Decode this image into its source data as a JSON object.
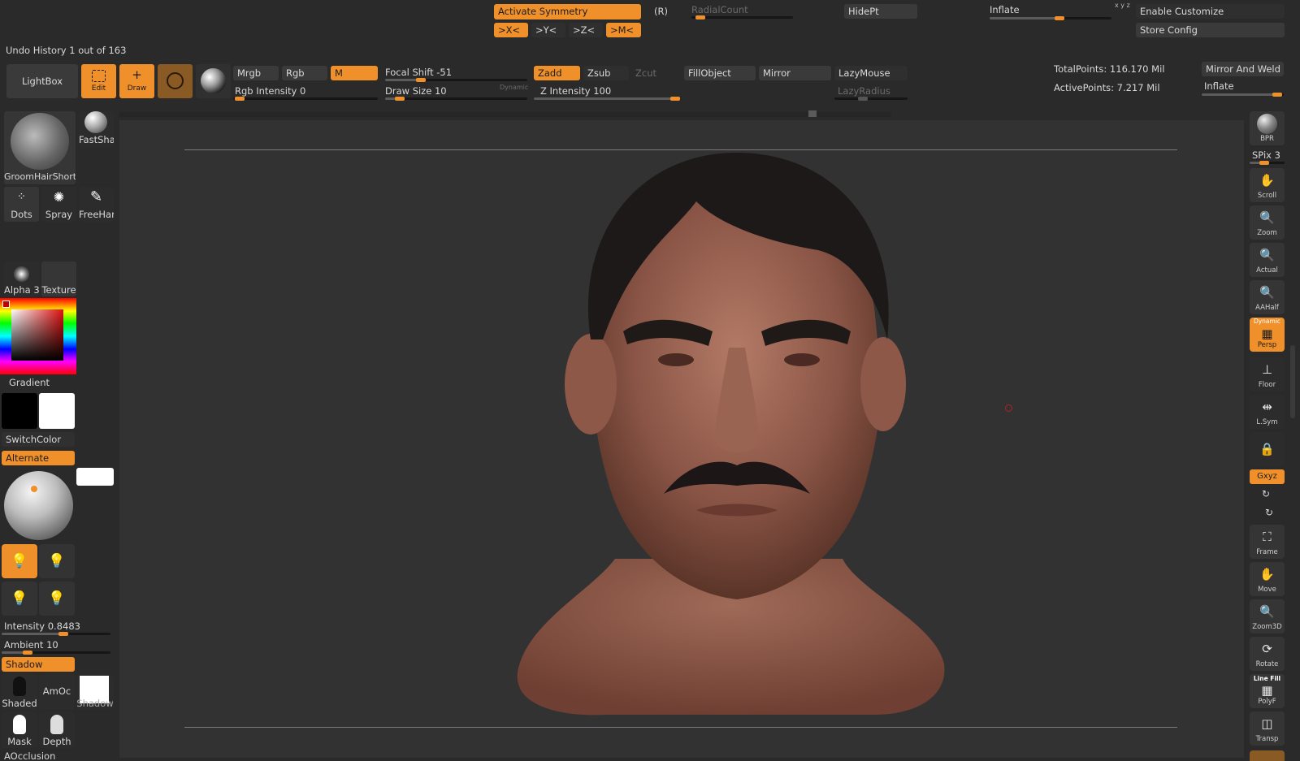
{
  "top": {
    "activate_symmetry": "Activate Symmetry",
    "radial_r": "(R)",
    "radial_count": "RadialCount",
    "hide_pt": "HidePt",
    "inflate_top": "Inflate",
    "xyz_glyph": "x y z",
    "enable_customize": "Enable Customize",
    "store_config": "Store Config",
    "axis_x": ">X<",
    "axis_y": ">Y<",
    "axis_z": ">Z<",
    "axis_m": ">M<",
    "undo_history": "Undo History 1 out of 163"
  },
  "shelf": {
    "lightbox": "LightBox",
    "edit": "Edit",
    "draw": "Draw",
    "mrgb": "Mrgb",
    "rgb": "Rgb",
    "m": "M",
    "rgb_intensity": "Rgb Intensity 0",
    "focal_shift": "Focal Shift -51",
    "draw_size": "Draw Size 10",
    "dynamic": "Dynamic",
    "zadd": "Zadd",
    "zsub": "Zsub",
    "zcut": "Zcut",
    "z_intensity": "Z Intensity 100",
    "fill_object": "FillObject",
    "mirror": "Mirror",
    "lazy_mouse": "LazyMouse",
    "lazy_radius": "LazyRadius",
    "total_points": "TotalPoints: 116.170 Mil",
    "active_points": "ActivePoints: 7.217 Mil",
    "mirror_and_weld": "Mirror And Weld",
    "inflate": "Inflate"
  },
  "left": {
    "brush": "GroomHairShort",
    "fast_shader": "FastSha",
    "dots": "Dots",
    "spray": "Spray",
    "freehand": "FreeHar",
    "alpha": "Alpha 3",
    "texture": "Texture",
    "gradient": "Gradient",
    "switch_color": "SwitchColor",
    "alternate": "Alternate",
    "intensity": "Intensity 0.8483",
    "ambient": "Ambient 10",
    "shadow": "Shadow",
    "shaded": "Shaded",
    "amoc": "AmOc",
    "shadow_thumb": "Shadow",
    "mask": "Mask",
    "depth": "Depth",
    "aocclusion": "AOcclusion"
  },
  "right": {
    "bpr": "BPR",
    "spix": "SPix 3",
    "scroll": "Scroll",
    "zoom": "Zoom",
    "actual": "Actual",
    "aahalf": "AAHalf",
    "dynamic": "Dynamic",
    "persp": "Persp",
    "floor": "Floor",
    "lsym": "L.Sym",
    "xyz": "Gxyz",
    "frame": "Frame",
    "move": "Move",
    "zoom3d": "Zoom3D",
    "rotate": "Rotate",
    "line_fill": "Line Fill",
    "polyf": "PolyF",
    "transp": "Transp"
  },
  "colors": {
    "accent": "#f0902a",
    "bg": "#2a2a2a",
    "canvas": "#323232",
    "button": "#3a3a3a"
  }
}
